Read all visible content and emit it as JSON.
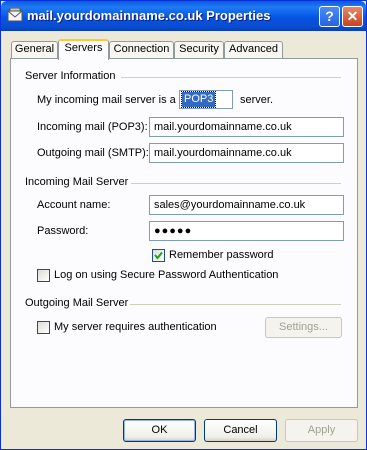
{
  "window": {
    "title": "mail.yourdomainname.co.uk Properties",
    "help_glyph": "?",
    "close_glyph": "✕"
  },
  "tabs": [
    {
      "label": "General"
    },
    {
      "label": "Servers"
    },
    {
      "label": "Connection"
    },
    {
      "label": "Security"
    },
    {
      "label": "Advanced"
    }
  ],
  "server_info": {
    "group_label": "Server Information",
    "incoming_type_label_pre": "My incoming mail server is a",
    "incoming_type_value": "POP3",
    "incoming_type_label_post": "server.",
    "incoming_label": "Incoming mail (POP3):",
    "incoming_value": "mail.yourdomainname.co.uk",
    "outgoing_label": "Outgoing mail (SMTP):",
    "outgoing_value": "mail.yourdomainname.co.uk"
  },
  "incoming_server": {
    "group_label": "Incoming Mail Server",
    "account_label": "Account name:",
    "account_value": "sales@yourdomainname.co.uk",
    "password_label": "Password:",
    "password_value": "●●●●●",
    "remember_label": "Remember password",
    "remember_checked": true,
    "spa_label": "Log on using Secure Password Authentication",
    "spa_checked": false
  },
  "outgoing_server": {
    "group_label": "Outgoing Mail Server",
    "auth_label": "My server requires authentication",
    "auth_checked": false,
    "settings_label": "Settings..."
  },
  "buttons": {
    "ok": "OK",
    "cancel": "Cancel",
    "apply": "Apply"
  }
}
